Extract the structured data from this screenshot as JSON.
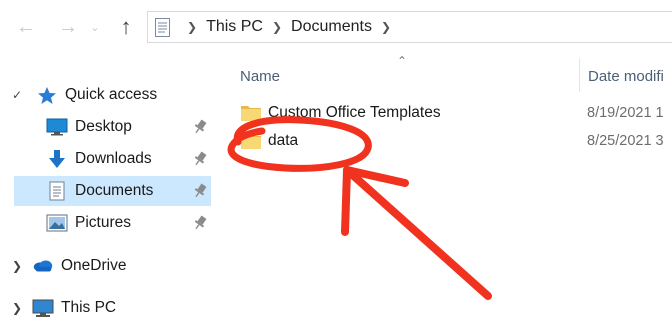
{
  "nav": {
    "back_icon": "arrow-left-icon",
    "forward_icon": "arrow-right-icon",
    "recent_icon": "chevron-down-icon",
    "up_icon": "arrow-up-icon"
  },
  "address": {
    "icon": "documents-folder-icon",
    "crumbs": [
      "This PC",
      "Documents"
    ]
  },
  "sidebar": {
    "items": [
      {
        "label": "Quick access",
        "icon": "star-icon",
        "chevron": "expanded"
      },
      {
        "label": "Desktop",
        "icon": "desktop-icon",
        "pinned": true
      },
      {
        "label": "Downloads",
        "icon": "download-arrow-icon",
        "pinned": true
      },
      {
        "label": "Documents",
        "icon": "document-icon",
        "pinned": true,
        "selected": true
      },
      {
        "label": "Pictures",
        "icon": "pictures-icon",
        "pinned": true
      },
      {
        "label": "OneDrive",
        "icon": "cloud-icon",
        "chevron": "collapsed"
      },
      {
        "label": "This PC",
        "icon": "computer-icon",
        "chevron": "collapsed"
      }
    ]
  },
  "content": {
    "columns": {
      "name": "Name",
      "date": "Date modifi"
    },
    "rows": [
      {
        "name": "Custom Office Templates",
        "date": "8/19/2021 1"
      },
      {
        "name": "data",
        "date": "8/25/2021 3"
      }
    ]
  },
  "colors": {
    "selected_bg": "#cce8ff",
    "folder_yellow": "#f8d775",
    "annotation_red": "#f0321e",
    "header_text": "#4b5f78"
  }
}
